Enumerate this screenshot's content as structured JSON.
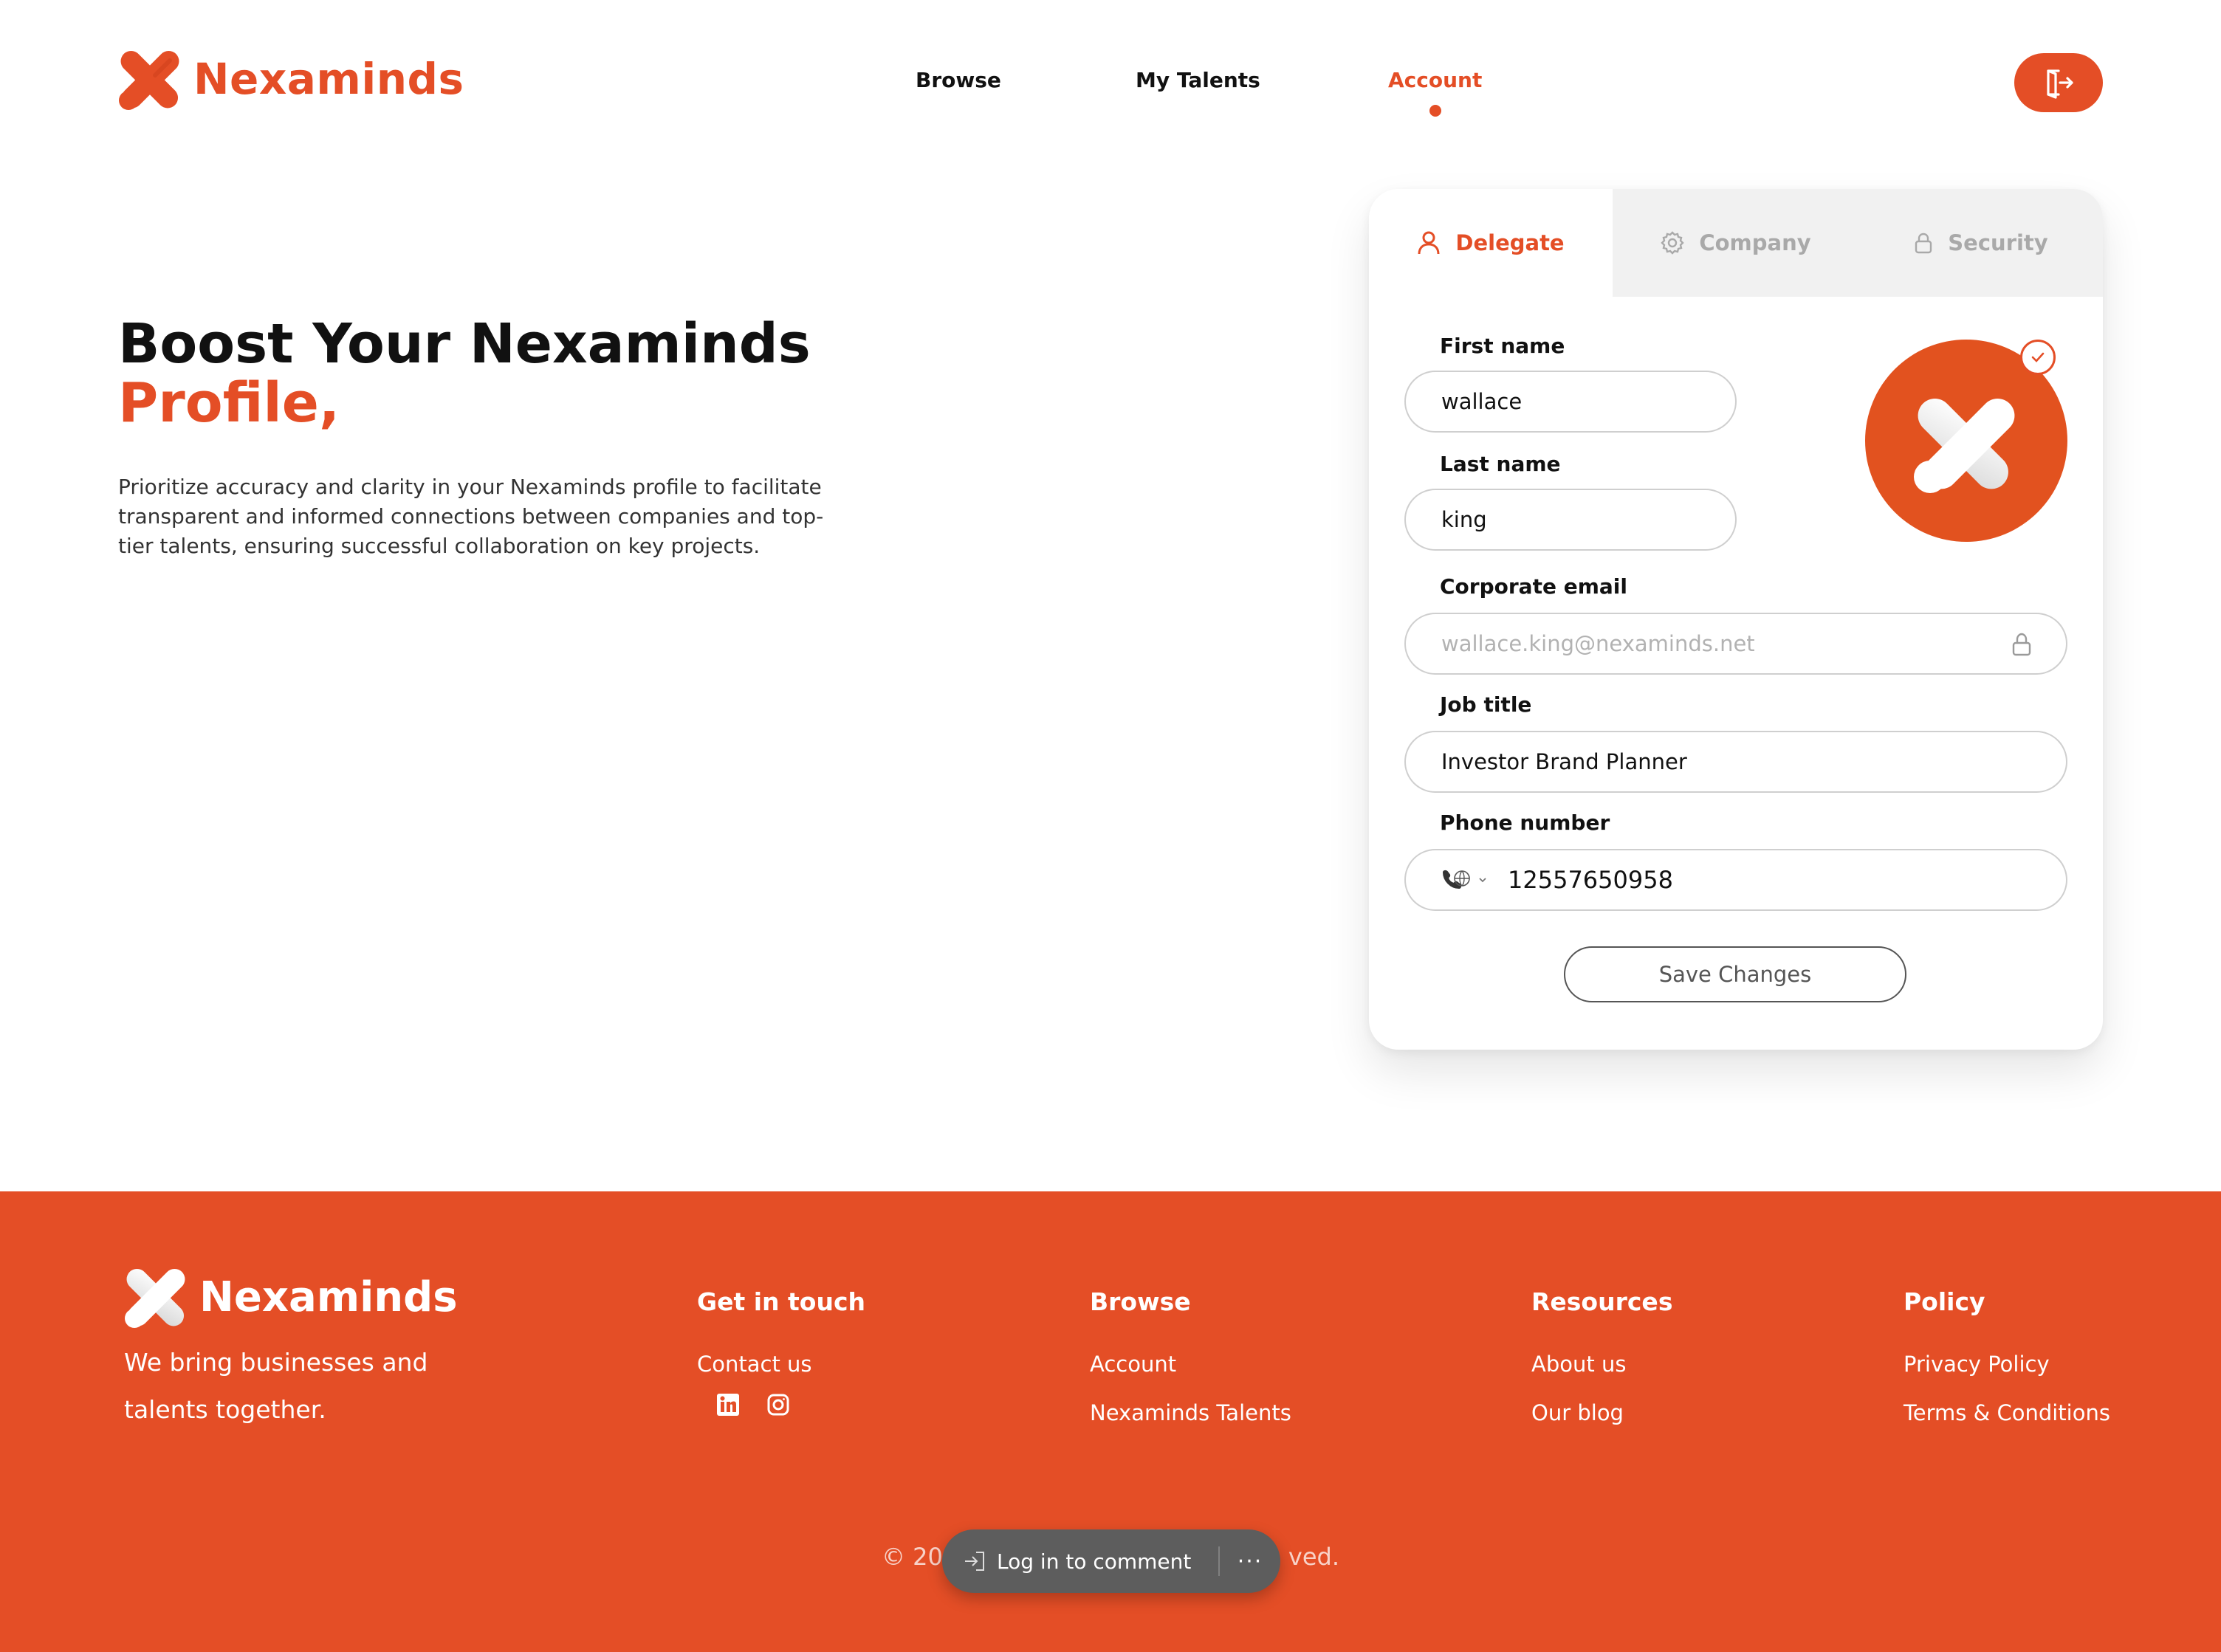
{
  "brand": {
    "name": "Nexaminds",
    "accent_color": "#e44e26"
  },
  "nav": {
    "items": [
      {
        "label": "Browse"
      },
      {
        "label": "My Talents"
      },
      {
        "label": "Account",
        "active": true
      }
    ],
    "logout_icon": "logout-icon"
  },
  "hero": {
    "title_line1": "Boost Your Nexaminds",
    "title_line2": "Profile,",
    "description": "Prioritize accuracy and clarity in your Nexaminds profile to facilitate transparent and informed connections between companies and top-tier talents, ensuring successful collaboration on key projects."
  },
  "profile_card": {
    "tabs": [
      {
        "label": "Delegate",
        "icon": "user-icon",
        "active": true
      },
      {
        "label": "Company",
        "icon": "gear-icon"
      },
      {
        "label": "Security",
        "icon": "lock-icon"
      }
    ],
    "fields": {
      "first_name": {
        "label": "First name",
        "value": "wallace"
      },
      "last_name": {
        "label": "Last name",
        "value": "king"
      },
      "email": {
        "label": "Corporate email",
        "value": "wallace.king@nexaminds.net",
        "locked": true
      },
      "job_title": {
        "label": "Job title",
        "value": "Investor Brand Planner"
      },
      "phone": {
        "label": "Phone number",
        "value": "12557650958",
        "country_icon": "globe-phone-icon"
      }
    },
    "save_label": "Save Changes"
  },
  "footer": {
    "tagline": "We bring businesses and talents together.",
    "columns": [
      {
        "title": "Get in touch",
        "links": [
          "Contact us"
        ],
        "social": [
          "linkedin-icon",
          "instagram-icon"
        ]
      },
      {
        "title": "Browse",
        "links": [
          "Account",
          "Nexaminds Talents"
        ]
      },
      {
        "title": "Resources",
        "links": [
          "About us",
          "Our blog"
        ]
      },
      {
        "title": "Policy",
        "links": [
          "Privacy Policy",
          "Terms & Conditions"
        ]
      }
    ],
    "copyright_left": "© 20",
    "copyright_right": "ved.",
    "comment_overlay": {
      "login_label": "Log in to comment",
      "more_label": "···"
    }
  }
}
